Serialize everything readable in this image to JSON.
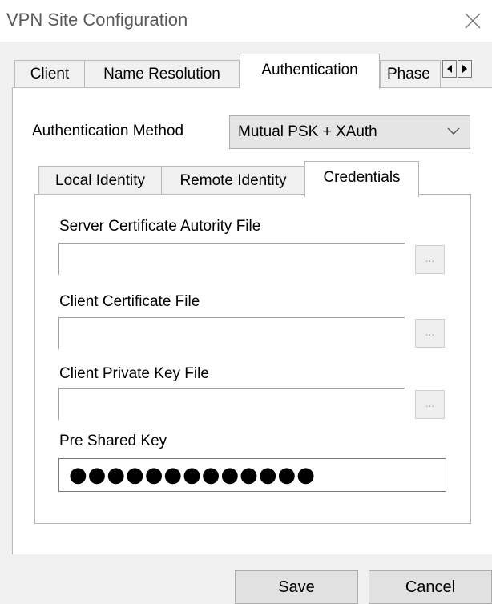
{
  "window": {
    "title": "VPN Site Configuration",
    "close_icon": "close-icon"
  },
  "outer_tabs": [
    {
      "label": "Client",
      "active": false
    },
    {
      "label": "Name Resolution",
      "active": false
    },
    {
      "label": "Authentication",
      "active": true
    },
    {
      "label": "Phase",
      "active": false
    }
  ],
  "auth": {
    "label": "Authentication Method",
    "selected": "Mutual PSK + XAuth"
  },
  "inner_tabs": [
    {
      "label": "Local Identity",
      "active": false
    },
    {
      "label": "Remote Identity",
      "active": false
    },
    {
      "label": "Credentials",
      "active": true
    }
  ],
  "credentials": {
    "server_ca_label": "Server Certificate Autority File",
    "server_ca_value": "",
    "client_cert_label": "Client Certificate File",
    "client_cert_value": "",
    "client_key_label": "Client Private Key File",
    "client_key_value": "",
    "browse_label": "...",
    "psk_label": "Pre Shared Key",
    "psk_value": "●●●●●●●●●●●●●"
  },
  "buttons": {
    "save": "Save",
    "cancel": "Cancel"
  }
}
